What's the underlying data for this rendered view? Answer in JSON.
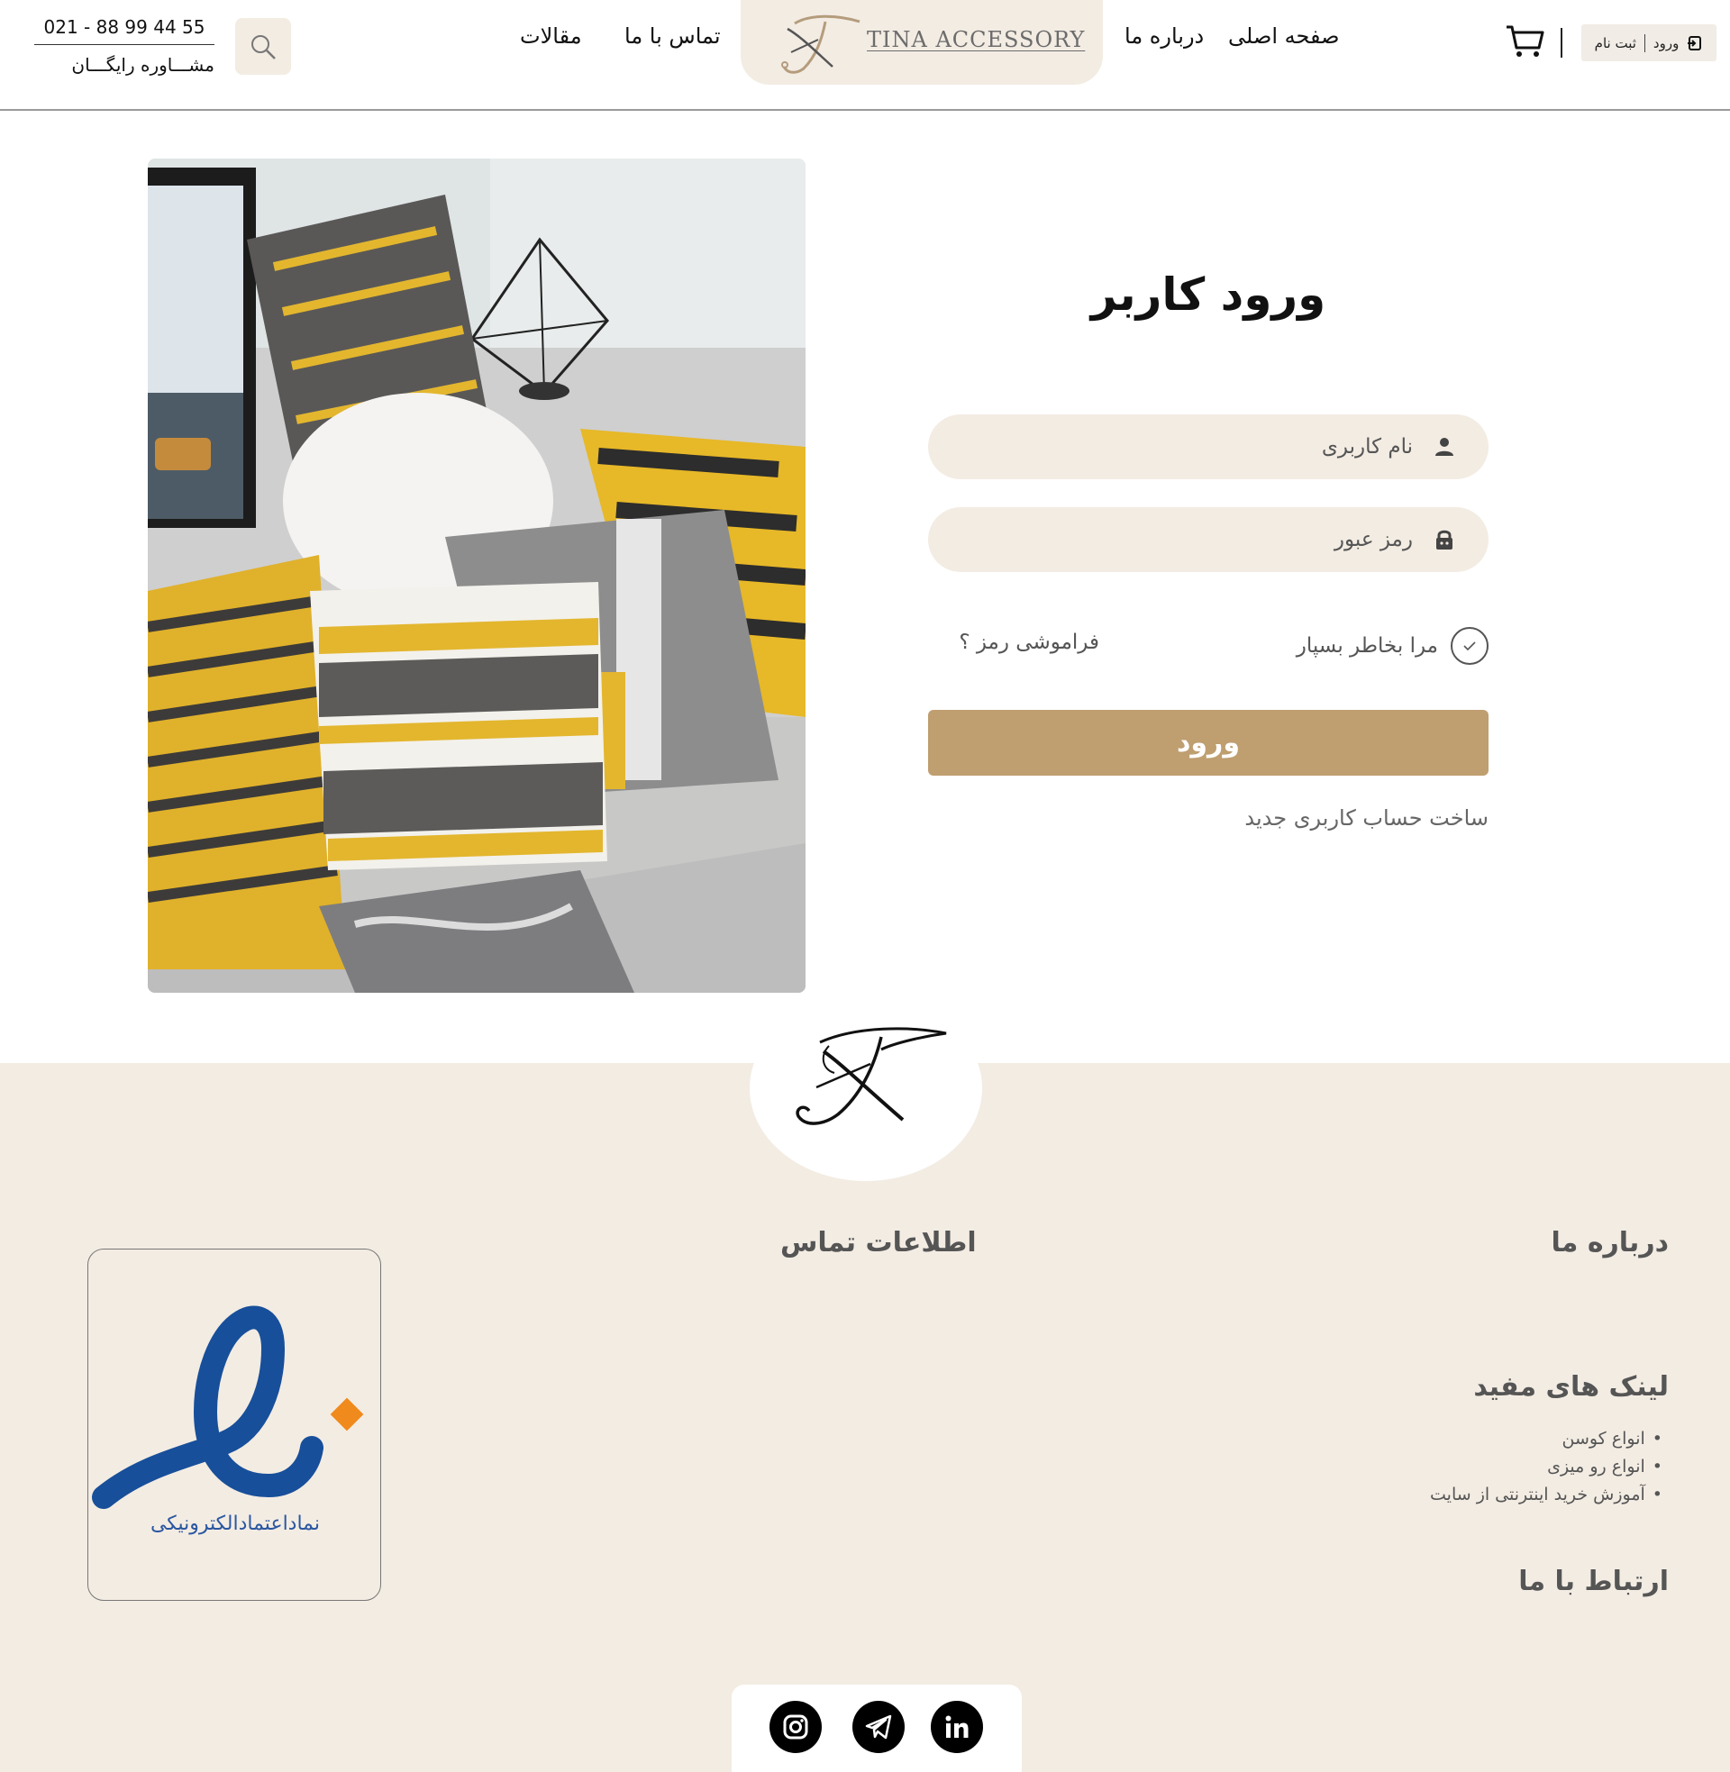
{
  "header": {
    "auth": {
      "login_label": "ورود",
      "register_label": "ثبت نام"
    },
    "nav": {
      "home": "صفحه اصلی",
      "about": "درباره ما",
      "contact": "تماس با ما",
      "articles": "مقالات"
    },
    "brand": {
      "name": "TINA ACCESSORY"
    },
    "phone": "021 - 88 99 44 55",
    "consult": "مشـــاوره رایگـــان"
  },
  "login": {
    "title": "ورود کاربر",
    "username_placeholder": "نام کاربری",
    "password_placeholder": "رمز عبور",
    "remember_label": "مرا بخاطر بسپار",
    "forgot_label": "فراموشی رمز ؟",
    "submit_label": "ورود",
    "register_link": "ساخت حساب کاربری جدید"
  },
  "footer": {
    "about_title": "درباره ما",
    "contact_title": "اطلاعات تماس",
    "links_title": "لینک های مفید",
    "links": [
      "انواع کوسن",
      "انواع رو میزی",
      "آموزش خرید اینترنتی از سایت"
    ],
    "connect_title": "ارتباط با ما",
    "enamad_text": "نماداعتمادالکترونیکی",
    "social": [
      "linkedin-icon",
      "telegram-icon",
      "instagram-icon"
    ]
  },
  "colors": {
    "accent": "#bf9e70",
    "beige": "#f3ece3",
    "enamad_blue": "#174f9a",
    "enamad_orange": "#f08a1c"
  }
}
